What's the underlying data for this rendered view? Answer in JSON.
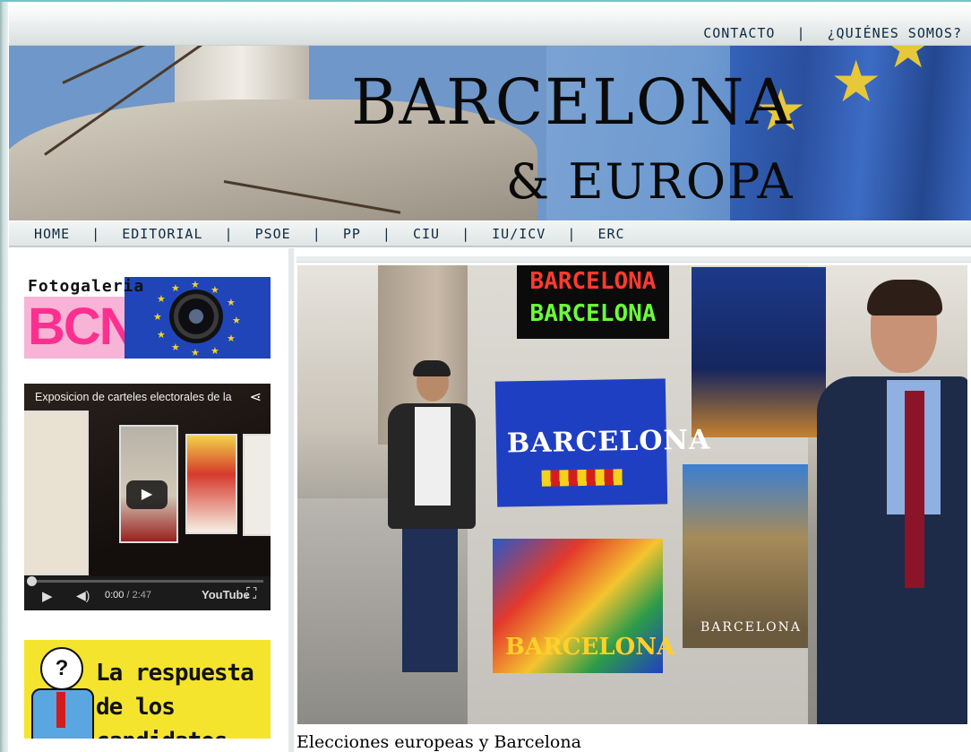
{
  "topnav": {
    "contacto": "CONTACTO",
    "separator": "|",
    "quienes": "¿QUIÉNES SOMOS?"
  },
  "banner": {
    "line1": "BARCELONA",
    "line2": "& EUROPA"
  },
  "mainnav": {
    "separator": "|",
    "items": [
      "HOME",
      "EDITORIAL",
      "PSOE",
      "PP",
      "CIU",
      "IU/ICV",
      "ERC"
    ]
  },
  "sidebar": {
    "fotogaleria": {
      "title": "Fotogaleria",
      "bcn": "BCN"
    },
    "video": {
      "title": "Exposicion de carteles electorales de la",
      "current_time": "0:00",
      "duration": "/ 2:47",
      "youtube": "YouTube"
    },
    "respuesta": {
      "text": "La respuesta de los candidatos"
    }
  },
  "main": {
    "photo_texts": {
      "neon1": "BARCELONA",
      "neon2": "BARCELONA",
      "card": "BARCELONA",
      "lizard": "BARCELONA",
      "batllo": "BARCELONA"
    },
    "caption": "Elecciones europeas y Barcelona"
  },
  "colors": {
    "nav_text": "#0f2a40",
    "flag_blue": "#2a4f9f",
    "star_gold": "#e6c83a",
    "bcn_pink": "#ff2f90"
  }
}
